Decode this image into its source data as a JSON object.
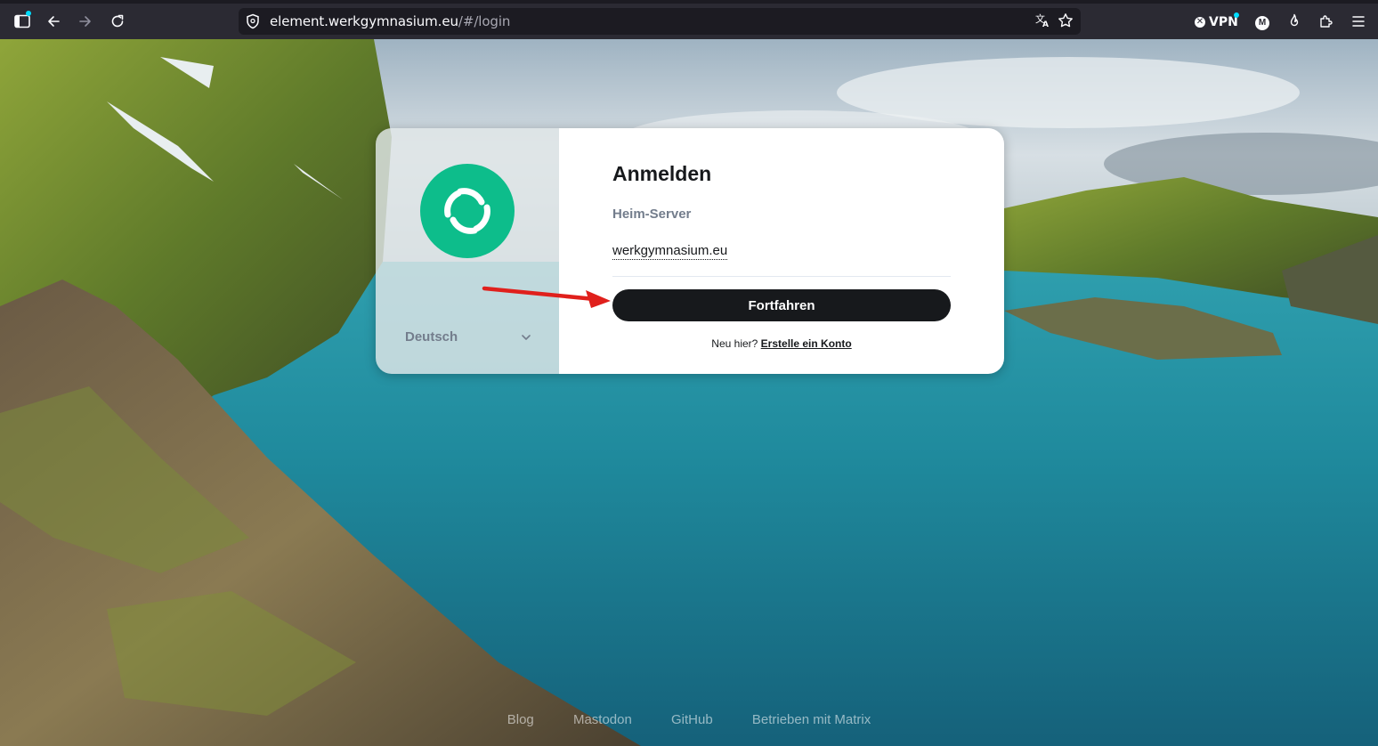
{
  "browser": {
    "url_host": "element.werkgymnasium.eu",
    "url_path": "/#/login",
    "vpn_label": "VPN",
    "account_initial": "M"
  },
  "auth": {
    "title": "Anmelden",
    "homeserver_label": "Heim-Server",
    "homeserver_value": "werkgymnasium.eu",
    "continue_label": "Fortfahren",
    "signup_prompt": "Neu hier?",
    "signup_link": "Erstelle ein Konto",
    "language": "Deutsch"
  },
  "footer": {
    "links": [
      "Blog",
      "Mastodon",
      "GitHub",
      "Betrieben mit Matrix"
    ]
  },
  "colors": {
    "accent": "#0dbd8b",
    "button": "#17191c",
    "chrome": "#2b2a33",
    "annotation_arrow": "#e0201c"
  }
}
